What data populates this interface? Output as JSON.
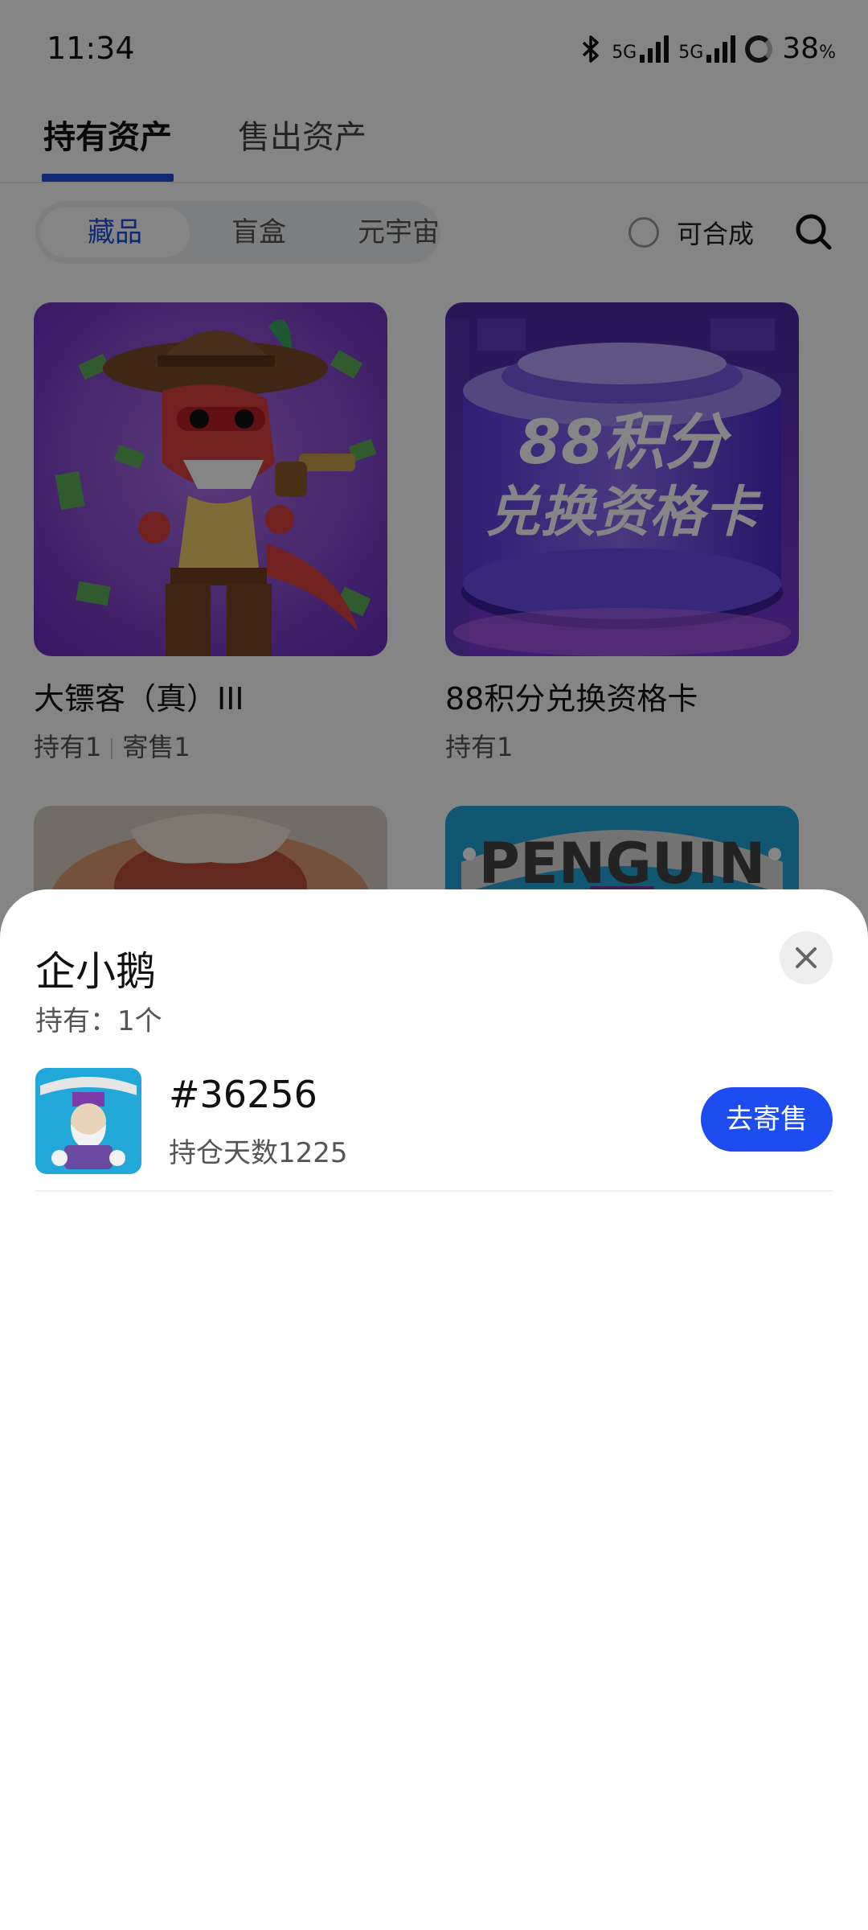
{
  "status_bar": {
    "time": "11:34",
    "network_1": "5G",
    "network_2": "5G",
    "battery_percent": "38",
    "battery_unit": "%"
  },
  "top_tabs": {
    "active": "持有资产",
    "inactive": "售出资产"
  },
  "filter": {
    "segments": [
      "藏品",
      "盲盒",
      "元宇宙"
    ],
    "selected_segment": "藏品",
    "composable_label": "可合成",
    "composable_checked": false
  },
  "cards": [
    {
      "title": "大镖客（真）III",
      "held": "持有1",
      "selling": "寄售1"
    },
    {
      "title": "88积分兑换资格卡",
      "held": "持有1",
      "image_line1": "88积分",
      "image_line2": "兑换资格卡"
    },
    {
      "title": ""
    },
    {
      "title": "",
      "image_text": "PENGUIN"
    }
  ],
  "sheet": {
    "title": "企小鹅",
    "count": "持有：1个",
    "items": [
      {
        "id": "#36256",
        "days": "持仓天数1225",
        "action": "去寄售"
      }
    ]
  },
  "colors": {
    "accent": "#1f4fe0",
    "button": "#1d4cf0"
  },
  "icons": [
    "bluetooth-icon",
    "signal-icon",
    "battery-icon",
    "search-icon",
    "close-icon"
  ]
}
